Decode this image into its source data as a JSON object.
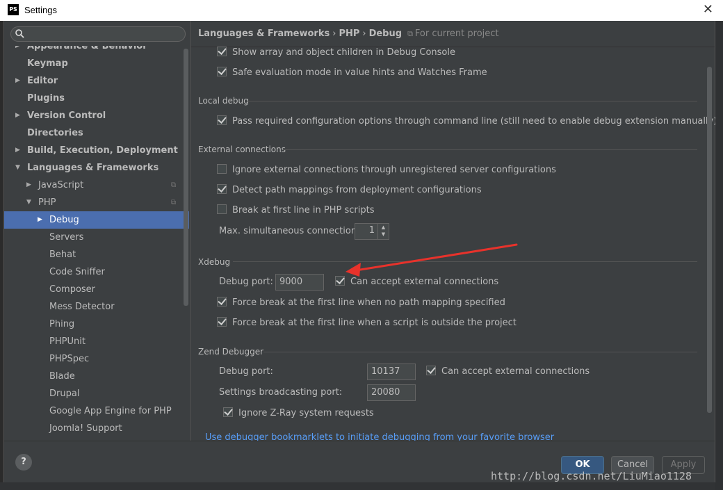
{
  "window": {
    "title": "Settings",
    "app_icon": "PS"
  },
  "search": {
    "placeholder": ""
  },
  "sidebar": {
    "items": [
      {
        "label": "Appearance & Behavior",
        "bold": true,
        "arrow": "▶",
        "indent": 0
      },
      {
        "label": "Keymap",
        "bold": true,
        "arrow": "",
        "indent": 0
      },
      {
        "label": "Editor",
        "bold": true,
        "arrow": "▶",
        "indent": 0
      },
      {
        "label": "Plugins",
        "bold": true,
        "arrow": "",
        "indent": 0
      },
      {
        "label": "Version Control",
        "bold": true,
        "arrow": "▶",
        "indent": 0
      },
      {
        "label": "Directories",
        "bold": true,
        "arrow": "",
        "indent": 0
      },
      {
        "label": "Build, Execution, Deployment",
        "bold": true,
        "arrow": "▶",
        "indent": 0
      },
      {
        "label": "Languages & Frameworks",
        "bold": true,
        "arrow": "▼",
        "indent": 0
      },
      {
        "label": "JavaScript",
        "bold": false,
        "arrow": "▶",
        "indent": 1,
        "project": true
      },
      {
        "label": "PHP",
        "bold": false,
        "arrow": "▼",
        "indent": 1,
        "project": true
      },
      {
        "label": "Debug",
        "bold": false,
        "arrow": "▶",
        "indent": 2,
        "selected": true
      },
      {
        "label": "Servers",
        "bold": false,
        "arrow": "",
        "indent": 2
      },
      {
        "label": "Behat",
        "bold": false,
        "arrow": "",
        "indent": 2
      },
      {
        "label": "Code Sniffer",
        "bold": false,
        "arrow": "",
        "indent": 2
      },
      {
        "label": "Composer",
        "bold": false,
        "arrow": "",
        "indent": 2
      },
      {
        "label": "Mess Detector",
        "bold": false,
        "arrow": "",
        "indent": 2
      },
      {
        "label": "Phing",
        "bold": false,
        "arrow": "",
        "indent": 2
      },
      {
        "label": "PHPUnit",
        "bold": false,
        "arrow": "",
        "indent": 2
      },
      {
        "label": "PHPSpec",
        "bold": false,
        "arrow": "",
        "indent": 2
      },
      {
        "label": "Blade",
        "bold": false,
        "arrow": "",
        "indent": 2
      },
      {
        "label": "Drupal",
        "bold": false,
        "arrow": "",
        "indent": 2
      },
      {
        "label": "Google App Engine for PHP",
        "bold": false,
        "arrow": "",
        "indent": 2
      },
      {
        "label": "Joomla! Support",
        "bold": false,
        "arrow": "",
        "indent": 2
      }
    ]
  },
  "breadcrumb": {
    "parts": [
      "Languages & Frameworks",
      "PHP",
      "Debug"
    ],
    "separator": "›",
    "scope": "For current project"
  },
  "general": {
    "show_array": {
      "label": "Show array and object children in Debug Console",
      "checked": true
    },
    "safe_eval": {
      "label": "Safe evaluation mode in value hints and Watches Frame",
      "checked": true
    }
  },
  "local_debug": {
    "title": "Local debug",
    "pass_config": {
      "label": "Pass required configuration options through command line (still need to enable debug extension manually)",
      "checked": true
    }
  },
  "external": {
    "title": "External connections",
    "ignore_unregistered": {
      "label": "Ignore external connections through unregistered server configurations",
      "checked": false
    },
    "detect_mappings": {
      "label": "Detect path mappings from deployment configurations",
      "checked": true
    },
    "break_first_line": {
      "label": "Break at first line in PHP scripts",
      "checked": false
    },
    "max_connections_label": "Max. simultaneous connections:",
    "max_connections_value": "1"
  },
  "xdebug": {
    "title": "Xdebug",
    "port_label": "Debug port:",
    "port_value": "9000",
    "accept_external": {
      "label": "Can accept external connections",
      "checked": true
    },
    "force_break_no_mapping": {
      "label": "Force break at the first line when no path mapping specified",
      "checked": true
    },
    "force_break_outside": {
      "label": "Force break at the first line when a script is outside the project",
      "checked": true
    }
  },
  "zend": {
    "title": "Zend Debugger",
    "port_label": "Debug port:",
    "port_value": "10137",
    "accept_external": {
      "label": "Can accept external connections",
      "checked": true
    },
    "broadcast_label": "Settings broadcasting port:",
    "broadcast_value": "20080",
    "ignore_zray": {
      "label": "Ignore Z-Ray system requests",
      "checked": true
    }
  },
  "link_text": "Use debugger bookmarklets to initiate debugging from your favorite browser",
  "footer": {
    "help": "?",
    "ok": "OK",
    "cancel": "Cancel",
    "apply": "Apply"
  },
  "annotation": {
    "color": "#e8322b"
  },
  "watermark": "http://blog.csdn.net/LiuMiao1128"
}
